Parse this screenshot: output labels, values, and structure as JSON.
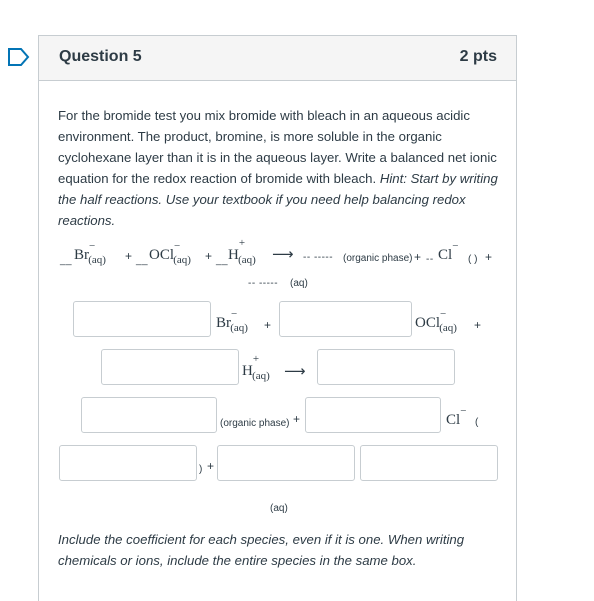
{
  "question": {
    "title": "Question 5",
    "points": "2 pts"
  },
  "prompt": {
    "text_before": "For the bromide test you mix bromide with bleach in an aqueous acidic environment. The product, bromine, is more soluble in the organic cyclohexane layer than it is in the aqueous layer. Write a balanced net ionic equation for the redox reaction of bromide with bleach. ",
    "hint": "Hint: Start by writing the half reactions. Use your textbook if you need help balancing redox reactions."
  },
  "equation": {
    "blank_short": "__",
    "blank_short2": "__",
    "blank_short3": "__",
    "blank_long": "-- -----",
    "blank_long2": "-- -----",
    "blank_cl": "--",
    "br": "Br",
    "ocl": "OCl",
    "h": "H",
    "cl": "Cl",
    "charge_minus": "−",
    "charge_plus": "+",
    "aq": "(aq)",
    "organic_phase": "(organic phase)",
    "cl_phase": "( )",
    "plus": "+",
    "arrow": "⟶"
  },
  "answer_rows": {
    "row1_br": "Br",
    "row1_aq": "(aq)",
    "row1_ocl": "OCl",
    "row1_ocl_aq": "(aq)",
    "row2_h": "H",
    "row2_aq": "(aq)",
    "row3_organic": "(organic phase)",
    "row3_cl": "Cl",
    "row3_paren": "(",
    "row4_close": ")",
    "row4_aq": "(aq)",
    "plus": "+",
    "arrow": "⟶",
    "minus": "−"
  },
  "footer": "Include the coefficient for each species, even if it is one. When writing chemicals or ions, include the entire species in the same box.",
  "colors": {
    "accent": "#0374b5",
    "text": "#2d3b45",
    "border": "#c7cdd1",
    "header_bg": "#f5f5f5"
  },
  "icons": {
    "flag": "bookmark-flag-icon"
  }
}
